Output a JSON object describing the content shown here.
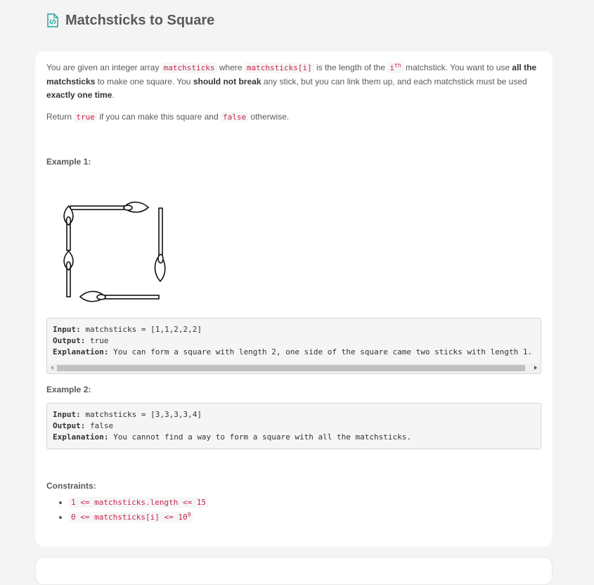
{
  "header": {
    "title": "Matchsticks to Square",
    "icon": "code-file-icon"
  },
  "description": {
    "p1": {
      "t1": "You are given an integer array ",
      "c1": "matchsticks",
      "t2": " where ",
      "c2": "matchsticks[i]",
      "t3": " is the length of the ",
      "c3": "i",
      "sup": "th",
      "t4": " matchstick. You want to use ",
      "b1": "all the matchsticks",
      "t5": " to make one square. You ",
      "b2": "should not break",
      "t6": " any stick, but you can link them up, and each matchstick must be used ",
      "b3": "exactly one time",
      "t7": "."
    },
    "p2": {
      "t1": "Return ",
      "c1": "true",
      "t2": " if you can make this square and ",
      "c2": "false",
      "t3": " otherwise."
    }
  },
  "example1": {
    "heading": "Example 1:",
    "input_label": "Input:",
    "input": " matchsticks = [1,1,2,2,2]",
    "output_label": "Output:",
    "output": " true",
    "explanation_label": "Explanation:",
    "explanation": " You can form a square with length 2, one side of the square came two sticks with length 1."
  },
  "example2": {
    "heading": "Example 2:",
    "input_label": "Input:",
    "input": " matchsticks = [3,3,3,3,4]",
    "output_label": "Output:",
    "output": " false",
    "explanation_label": "Explanation:",
    "explanation": " You cannot find a way to form a square with all the matchsticks."
  },
  "constraints": {
    "heading": "Constraints:",
    "c1": "1 <= matchsticks.length <= 15",
    "c2_base": "0 <= matchsticks[i] <= 10",
    "c2_sup": "9"
  },
  "colors": {
    "code_text": "#c7254e",
    "background": "#f4f4f4",
    "icon_accent": "#1aa397"
  }
}
